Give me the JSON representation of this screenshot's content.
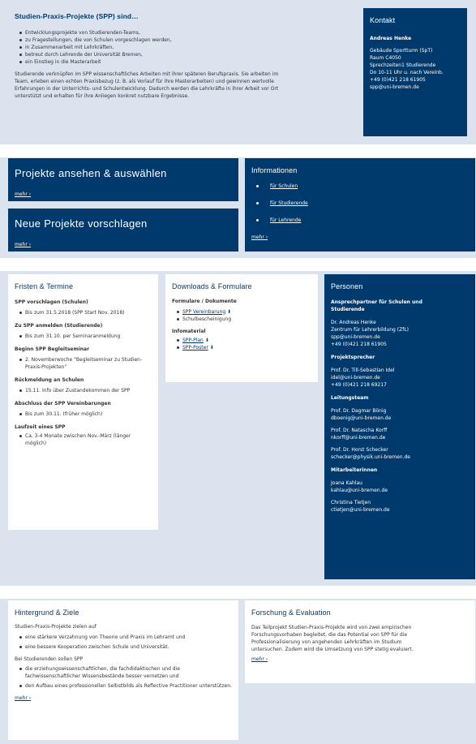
{
  "intro": {
    "title": "Studien-Praxis-Projekte (SPP) sind…",
    "bullets": [
      "Entwicklungsprojekte von Studierenden-Teams,",
      "zu Fragestellungen, die von Schulen vorgeschlagen werden,",
      "in Zusammenarbeit mit Lehrkräften,",
      "betreut durch Lehrende der Universität Bremen,",
      "ein Einstieg in die Masterarbeit"
    ],
    "para": [
      "Studierende verknüpfen im SPP wissenschaftliches Arbeiten mit ihrer späteren Berufspraxis. Sie arbeiten im",
      "Team, erleben einen echten Praxisbezug (z. B. als Vorlauf für ihre Masterarbeiten) und gewinnen wertvolle",
      "Erfahrungen in der Unterrichts- und Schulentwicklung. Dadurch werden die Lehrkräfte in ihrer Arbeit vor Ort",
      "unterstützt und erhalten für ihre Anliegen konkret nutzbare Ergebnisse."
    ]
  },
  "kontakt": {
    "title": "Kontakt",
    "name": "Andreas Henke",
    "lines": [
      "Gebäude Sportturm (SpT)",
      "Raum C4050",
      "Sprechzeiten1 Studierende",
      "Do 10-11 Uhr u. nach Vereinb.",
      "+49 (0)421 218 61905",
      "spp@uni-bremen.de"
    ]
  },
  "projekte_ansehen": {
    "title": "Projekte ansehen & auswählen",
    "more": "mehr ›"
  },
  "projekte_vorschlagen": {
    "title": "Neue Projekte vorschlagen",
    "more": "mehr ›"
  },
  "informationen": {
    "title": "Informationen",
    "links": [
      "für Schulen",
      "für Studierende",
      "für Lehrende"
    ],
    "more": "mehr ›"
  },
  "fristen": {
    "title": "Fristen & Termine",
    "groups": [
      {
        "head": "SPP vorschlagen (Schulen)",
        "items": [
          "Bis zum 31.5.2018 (SPP Start Nov. 2018)"
        ]
      },
      {
        "head": "Zu SPP anmelden (Studierende)",
        "items": [
          "Bis zum 31.10. per Seminaranmeldung"
        ]
      },
      {
        "head": "Beginn SPP Begleitseminar",
        "items": [
          "2. Novemberwoche \"Begleitseminar zu Studien-Praxis-Projekten\""
        ]
      },
      {
        "head": "Rückmeldung an Schulen",
        "items": [
          "15.11. Info über Zustandekommen der SPP"
        ]
      },
      {
        "head": "Abschluss der SPP Vereinbarungen",
        "items": [
          "Bis zum 30.11. (früher möglich)"
        ]
      },
      {
        "head": "Laufzeit eines SPP",
        "items": [
          "Ca. 3-4 Monate zwischen Nov.-März (länger möglich)"
        ]
      }
    ]
  },
  "downloads": {
    "title": "Downloads & Formulare",
    "sub1": "Formulare / Dokumente",
    "items1": [
      "SPP Vereinbarung",
      "Schulbescheinigung"
    ],
    "sub2": "Infomaterial",
    "items2": [
      "SPP-Plan",
      "SPP-Poster"
    ],
    "download_icon": "download-icon"
  },
  "personen": {
    "title": "Personen",
    "sections": [
      {
        "head": "Ansprechpartner für Schulen und Studierende",
        "entries": [
          [
            "Dr. Andreas Henke",
            "Zentrum für Lehrerbildung (ZfL)",
            "spp@uni-bremen.de",
            "+49 (0)421 218 61905"
          ]
        ]
      },
      {
        "head": "Projektsprecher",
        "entries": [
          [
            "Prof. Dr. Till-Sebastian Idel",
            "idel@uni-bremen.de",
            "+49 (0)421 218 69217"
          ]
        ]
      },
      {
        "head": "Leitungsteam",
        "entries": [
          [
            "Prof. Dr. Dagmar Bönig",
            "dboenig@uni-bremen.de"
          ],
          [
            "Prof. Dr. Natascha Korff",
            "nkorff@uni-bremen.de"
          ],
          [
            "Prof. Dr. Horst Schecker",
            "schecker@physik.uni-bremen.de"
          ]
        ]
      },
      {
        "head": "Mitarbeiterinnen",
        "entries": [
          [
            "Joana Kahlau",
            "kahlau@uni-bremen.de"
          ],
          [
            "Christina Tietjen",
            "ctietjen@uni-bremen.de"
          ]
        ]
      }
    ]
  },
  "hintergrund": {
    "title": "Hintergrund & Ziele",
    "intro": "Studien-Praxis-Projekte zielen auf",
    "items1": [
      "eine stärkere Verzahnung von Theorie und Praxis im Lehramt und",
      "eine bessere Kooperation zwischen Schule und Universität."
    ],
    "intro2": "Bei Studierenden sollen SPP",
    "items2": [
      "die erziehungswissenschaftlichen, die fachdidaktischen und die fachwissenschaftlicher Wissensbestände besser vernetzen und",
      "den Aufbau eines professionellen Selbstbilds als Reflective Practitioner unterstützen."
    ],
    "more": "mehr ›"
  },
  "forschung": {
    "title": "Forschung & Evaluation",
    "para": [
      "Das Teilprojekt Studien-Praxis-Projekte wird von zwei empirischen",
      "Forschungsvorhaben begleitet, die das Potential von SPP für die",
      "Professionalisierung von angehenden Lehrkräften im Studium",
      "untersuchen. Zudem wird die Umsetzung von SPP stetig evaluiert."
    ],
    "more": "mehr ›"
  },
  "colors": {
    "blue": "#003a6c",
    "background": "#dbe4ee",
    "white": "#ffffff"
  }
}
